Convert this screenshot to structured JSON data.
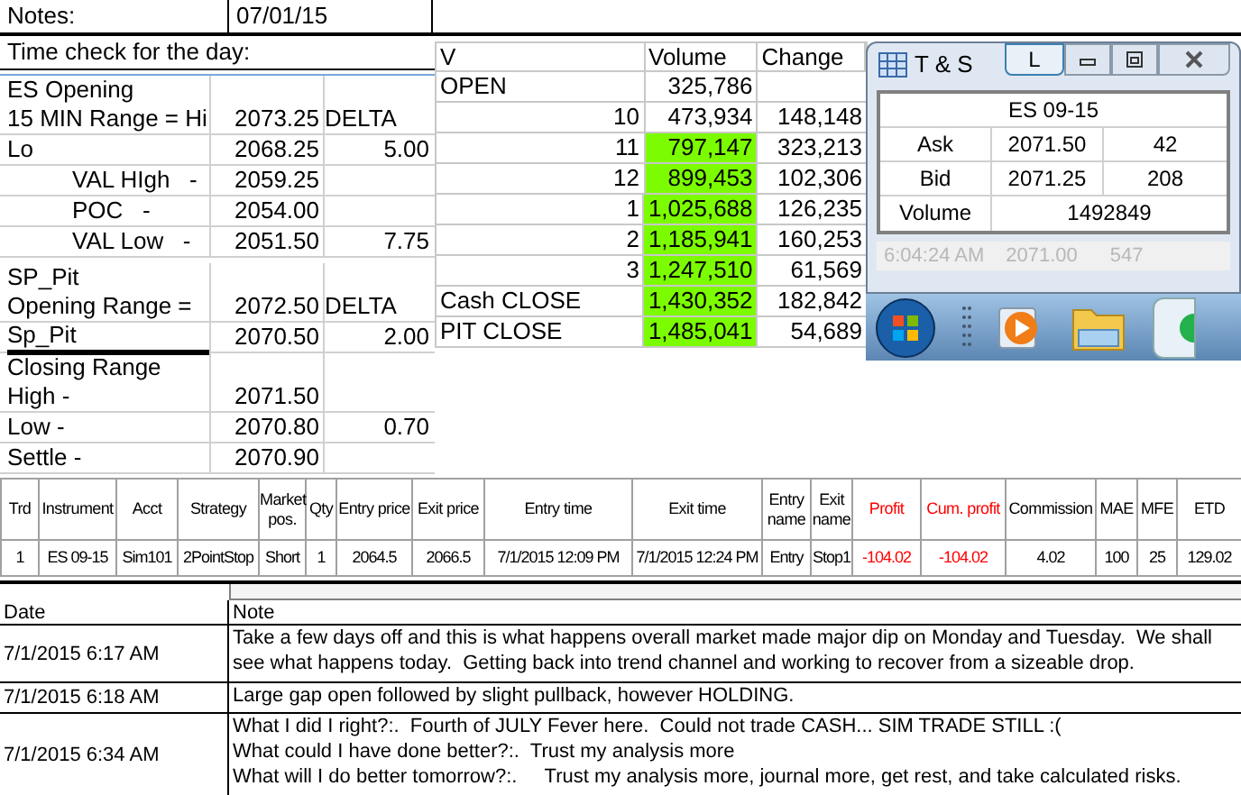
{
  "header": {
    "label": "Notes:",
    "date": "07/01/15"
  },
  "time_check": "Time check for the day:",
  "es_block": [
    {
      "kind": "main",
      "title": "ES Opening",
      "label": "15 MIN Range = Hi",
      "value": "2073.25",
      "tag": "DELTA"
    },
    {
      "kind": "main",
      "label": "Lo",
      "value": "2068.25",
      "difference": "5.00"
    },
    {
      "kind": "sub",
      "label": "VAL HIgh   -",
      "value": "2059.25"
    },
    {
      "kind": "sub",
      "label": "POC   -",
      "value": "2054.00"
    },
    {
      "kind": "sub",
      "label": "VAL Low   -",
      "value": "2051.50",
      "difference": "7.75"
    }
  ],
  "pit_block": [
    {
      "kind": "main",
      "title": "SP_Pit",
      "label": "Opening Range =",
      "value": "2072.50",
      "tag": "DELTA"
    },
    {
      "kind": "marked",
      "label": "Sp_Pit",
      "value": "2070.50",
      "difference": "2.00"
    },
    {
      "kind": "main",
      "title": "Closing Range",
      "label": "High -",
      "value": "2071.50"
    },
    {
      "kind": "main",
      "label": "Low -",
      "value": "2070.80",
      "difference": "0.70"
    },
    {
      "kind": "main",
      "label": "Settle -",
      "value": "2070.90"
    }
  ],
  "volume_table": {
    "columns": [
      "V",
      "Volume",
      "Change"
    ],
    "rows": [
      {
        "label": "OPEN",
        "volume": "325,786",
        "highlight": false
      },
      {
        "hour": "10",
        "volume": "473,934",
        "change": "148,148",
        "highlight": false
      },
      {
        "hour": "11",
        "volume": "797,147",
        "change": "323,213",
        "highlight": true
      },
      {
        "hour": "12",
        "volume": "899,453",
        "change": "102,306",
        "highlight": true
      },
      {
        "hour": "1",
        "volume": "1,025,688",
        "change": "126,235",
        "highlight": true
      },
      {
        "hour": "2",
        "volume": "1,185,941",
        "change": "160,253",
        "highlight": true
      },
      {
        "hour": "3",
        "volume": "1,247,510",
        "change": "61,569",
        "highlight": true
      },
      {
        "label": "Cash CLOSE",
        "volume": "1,430,352",
        "change": "182,842",
        "highlight": true
      },
      {
        "label": "PIT CLOSE",
        "volume": "1,485,041",
        "change": "54,689",
        "highlight": true
      }
    ]
  },
  "ts_window": {
    "title": "T & S",
    "link_button": "L",
    "instrument": "ES 09-15",
    "quotes": [
      {
        "label": "Ask",
        "price": "2071.50",
        "size": "42"
      },
      {
        "label": "Bid",
        "price": "2071.25",
        "size": "208"
      }
    ],
    "volume": {
      "label": "Volume",
      "value": "1492849"
    },
    "last_trade": {
      "time": "6:04:24 AM",
      "price": "2071.00",
      "size": "547"
    }
  },
  "trades": {
    "columns": [
      {
        "label": "Trd"
      },
      {
        "label": "Instrument"
      },
      {
        "label": "Acct"
      },
      {
        "label": "Strategy"
      },
      {
        "label": "Market pos."
      },
      {
        "label": "Qty"
      },
      {
        "label": "Entry price"
      },
      {
        "label": "Exit price"
      },
      {
        "label": "Entry time"
      },
      {
        "label": "Exit time"
      },
      {
        "label": "Entry name"
      },
      {
        "label": "Exit name"
      },
      {
        "label": "Profit",
        "color": "#ff0000"
      },
      {
        "label": "Cum. profit",
        "color": "#ff0000"
      },
      {
        "label": "Commission"
      },
      {
        "label": "MAE"
      },
      {
        "label": "MFE"
      },
      {
        "label": "ETD"
      }
    ],
    "rows": [
      [
        "1",
        "ES 09-15",
        "Sim101",
        "2PointStop",
        "Short",
        "1",
        "2064.5",
        "2066.5",
        "7/1/2015 12:09 PM",
        "7/1/2015 12:24 PM",
        "Entry",
        "Stop1",
        "-104.02",
        "-104.02",
        "4.02",
        "100",
        "25",
        "129.02"
      ]
    ]
  },
  "notes": {
    "columns": [
      "Date",
      "Note"
    ],
    "rows": [
      {
        "date": "7/1/2015 6:17 AM",
        "lines": [
          "Take a few days off and this is what happens overall market made major dip on Monday and Tuesday.  We shall see what happens today.  Getting back into trend channel and working to recover from a sizeable drop."
        ]
      },
      {
        "date": "7/1/2015 6:18 AM",
        "lines": [
          "Large gap open followed by slight pullback, however HOLDING."
        ]
      },
      {
        "date": "7/1/2015 6:34 AM",
        "lines": [
          "What I did I right?:.  Fourth of JULY Fever here.  Could not trade CASH... SIM TRADE STILL :(",
          "What could I have done better?:.  Trust my analysis more",
          "What will I do better tomorrow?:.     Trust my analysis more, journal more, get rest, and take calculated risks."
        ]
      }
    ]
  }
}
